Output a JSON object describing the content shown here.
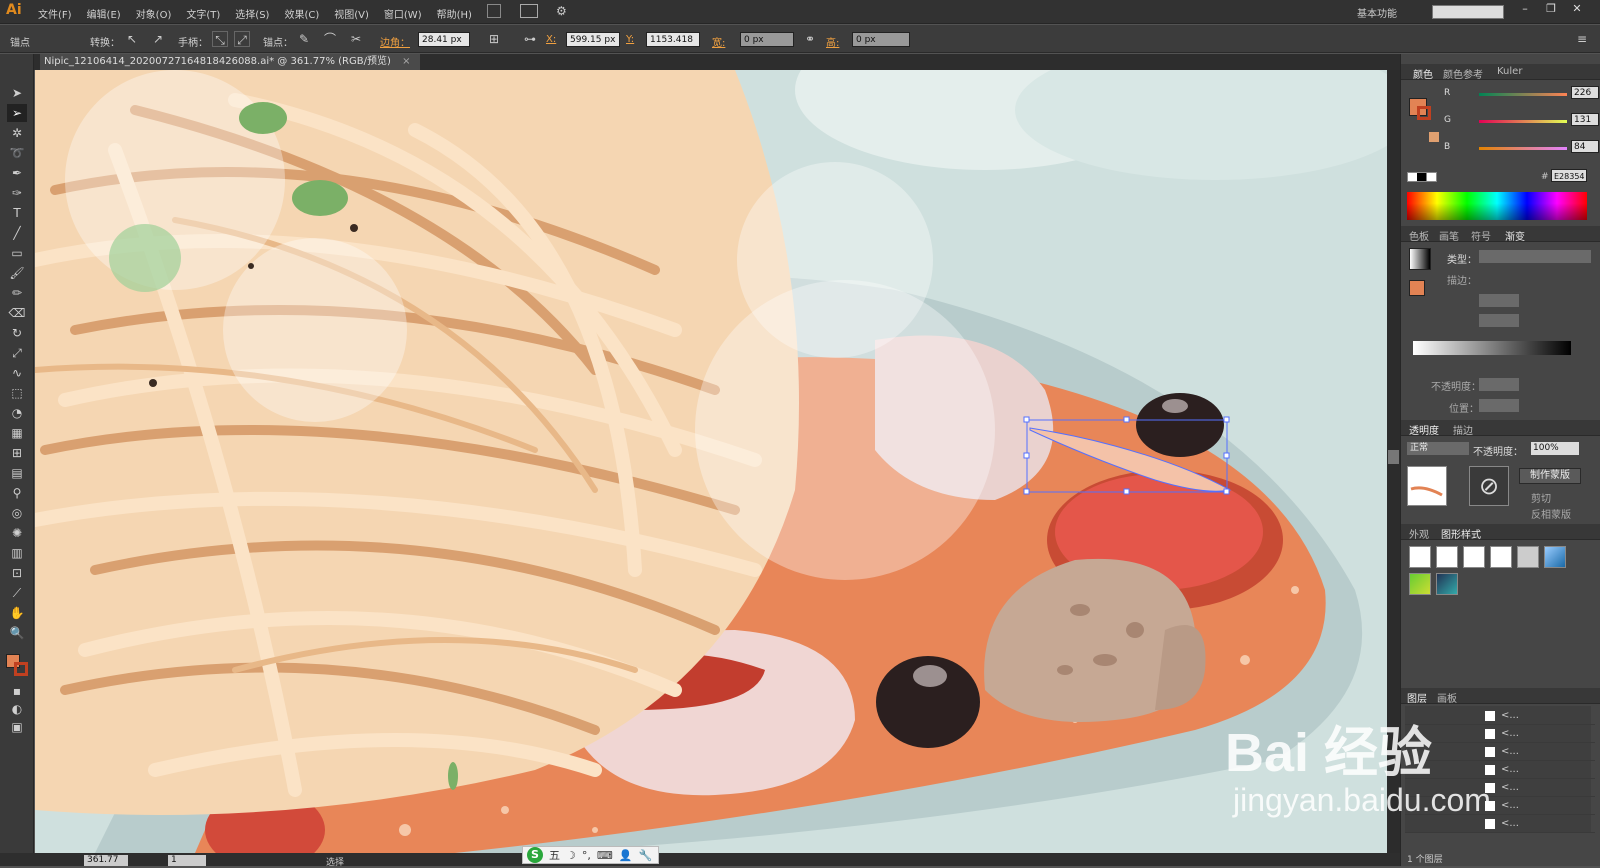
{
  "app": {
    "logo": "Ai",
    "menus": [
      "文件(F)",
      "编辑(E)",
      "对象(O)",
      "文字(T)",
      "选择(S)",
      "效果(C)",
      "视图(V)",
      "窗口(W)",
      "帮助(H)"
    ],
    "workspace": "基本功能"
  },
  "control_bar": {
    "anchor_label": "锚点",
    "convert_label": "转换：",
    "handle_label": "手柄：",
    "anchor_label2": "锚点：",
    "corner_label": "边角：",
    "corner_value": "28.41 px",
    "x_label": "X:",
    "x_value": "599.15 px",
    "y_label": "Y:",
    "y_value": "1153.418",
    "w_label": "宽:",
    "w_value": "0 px",
    "h_label": "高:",
    "h_value": "0 px"
  },
  "document": {
    "tab_title": "Nipic_12106414_20200727164818426088.ai* @ 361.77% (RGB/预览)"
  },
  "status": {
    "zoom": "361.77",
    "page": "1",
    "tool_text": "选择"
  },
  "ime": {
    "label": "五"
  },
  "color_panel": {
    "tabs": [
      "颜色",
      "颜色参考",
      "Kuler"
    ],
    "r_label": "R",
    "r_value": "226",
    "g_label": "G",
    "g_value": "131",
    "b_label": "B",
    "b_value": "84",
    "hex_prefix": "#",
    "hex_value": "E28354",
    "fill_color": "#e28354"
  },
  "gradient_panel": {
    "tabs": [
      "色板",
      "画笔",
      "符号",
      "渐变"
    ],
    "type_label": "类型：",
    "stroke_label": "描边：",
    "opacity_label": "不透明度：",
    "position_label": "位置："
  },
  "transparency_panel": {
    "tabs": [
      "透明度",
      "描边"
    ],
    "mode": "正常",
    "opacity_label": "不透明度：",
    "opacity_value": "100%",
    "make_mask": "制作蒙版",
    "clip": "剪切",
    "invert": "反相蒙版"
  },
  "graphic_styles": {
    "tabs": [
      "外观",
      "图形样式"
    ]
  },
  "layers_panel": {
    "tabs": [
      "图层",
      "画板"
    ],
    "footer": "1 个图层",
    "row_label": "<..."
  },
  "watermark": {
    "brand": "Bai 经验",
    "url": "jingyan.baidu.com"
  }
}
